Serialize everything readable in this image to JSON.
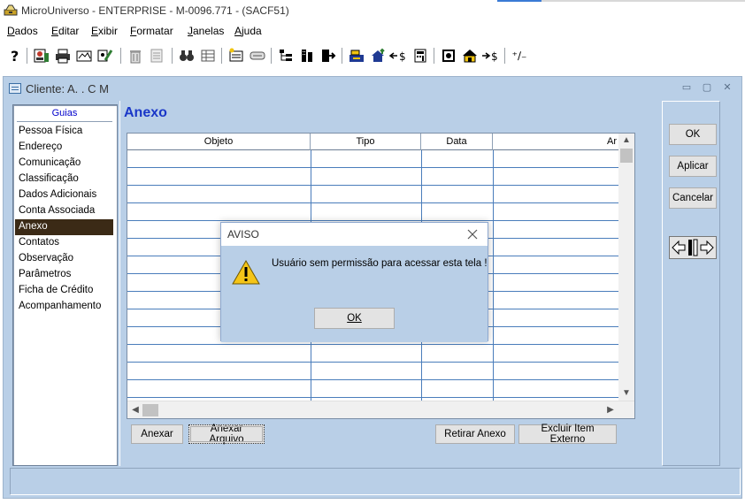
{
  "window": {
    "title": "MicroUniverso - ENTERPRISE - M-0096.771 - (SACF51)"
  },
  "menu": [
    {
      "label": "Dados"
    },
    {
      "label": "Editar"
    },
    {
      "label": "Exibir"
    },
    {
      "label": "Formatar"
    },
    {
      "label": "Janelas"
    },
    {
      "label": "Ajuda"
    }
  ],
  "toolbar": {
    "currency_label_1": "$",
    "currency_label_2": "$",
    "plusminus_label": "⁺∕₋"
  },
  "client": {
    "title": "Cliente: A.  . C M"
  },
  "nav": {
    "header": "Guias",
    "items": [
      {
        "label": "Pessoa Física"
      },
      {
        "label": "Endereço"
      },
      {
        "label": "Comunicação"
      },
      {
        "label": "Classificação"
      },
      {
        "label": "Dados Adicionais"
      },
      {
        "label": "Conta Associada"
      },
      {
        "label": "Anexo",
        "selected": true
      },
      {
        "label": "Contatos"
      },
      {
        "label": "Observação"
      },
      {
        "label": "Parâmetros"
      },
      {
        "label": "Ficha de Crédito"
      },
      {
        "label": "Acompanhamento"
      }
    ]
  },
  "main": {
    "title": "Anexo",
    "columns": [
      "Objeto",
      "Tipo",
      "Data",
      "Ar"
    ],
    "buttons": {
      "anexar": "Anexar",
      "anexar_arquivo": "Anexar Arquivo",
      "retirar_anexo": "Retirar Anexo",
      "excluir_item_externo": "Excluir Item Externo"
    }
  },
  "side_buttons": {
    "ok": "OK",
    "aplicar": "Aplicar",
    "cancelar": "Cancelar"
  },
  "dialog": {
    "title": "AVISO",
    "message": "Usuário sem permissão para acessar esta tela !",
    "ok_label": "OK"
  },
  "colors": {
    "panel_bg": "#b9cfe7",
    "title_blue": "#1a37c8",
    "selected_nav": "#3b2a16",
    "grid_lines": "#4a7dbb"
  }
}
